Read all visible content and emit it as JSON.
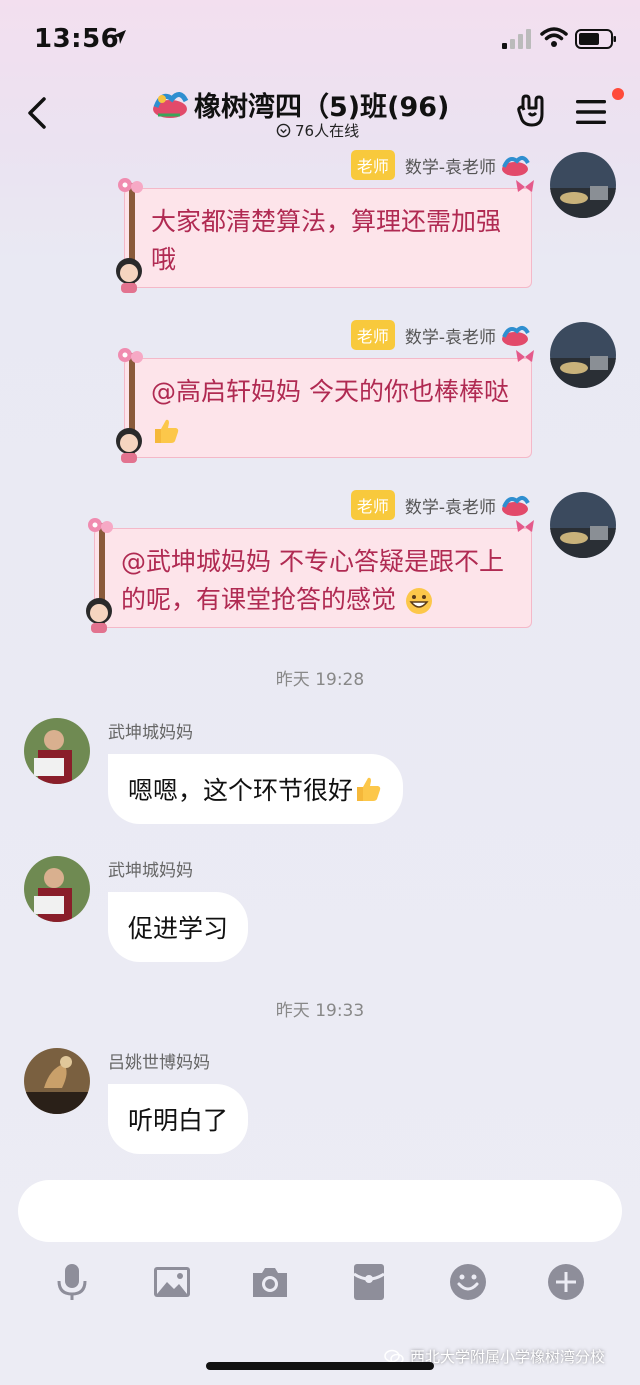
{
  "status_bar": {
    "time": "13:56"
  },
  "header": {
    "title": "橡树湾四（5)班(96)",
    "online": "76人在线"
  },
  "teacher_messages": [
    {
      "badge": "老师",
      "name": "数学-袁老师",
      "lines": [
        "大家都清楚算法，算理还需加强",
        "哦"
      ]
    },
    {
      "badge": "老师",
      "name": "数学-袁老师",
      "lines": [
        "@高启轩妈妈 今天的你也棒棒哒"
      ]
    },
    {
      "badge": "老师",
      "name": "数学-袁老师",
      "lines": [
        "@武坤城妈妈 不专心答疑是跟不上",
        "的呢，有课堂抢答的感觉"
      ]
    }
  ],
  "time_separators": [
    "昨天 19:28",
    "昨天 19:33"
  ],
  "user_messages": [
    {
      "name": "武坤城妈妈",
      "text": "嗯嗯，这个环节很好"
    },
    {
      "name": "武坤城妈妈",
      "text": "促进学习"
    },
    {
      "name": "吕姚世博妈妈",
      "text": "听明白了"
    }
  ],
  "input": {
    "value": ""
  },
  "watermark": "西北大学附属小学橡树湾分校",
  "colors": {
    "badge": "#f8c93c",
    "bubble_text": "#b02a52",
    "bubble_bg": "#fde4ea",
    "notification_dot": "#ff4b3a"
  }
}
